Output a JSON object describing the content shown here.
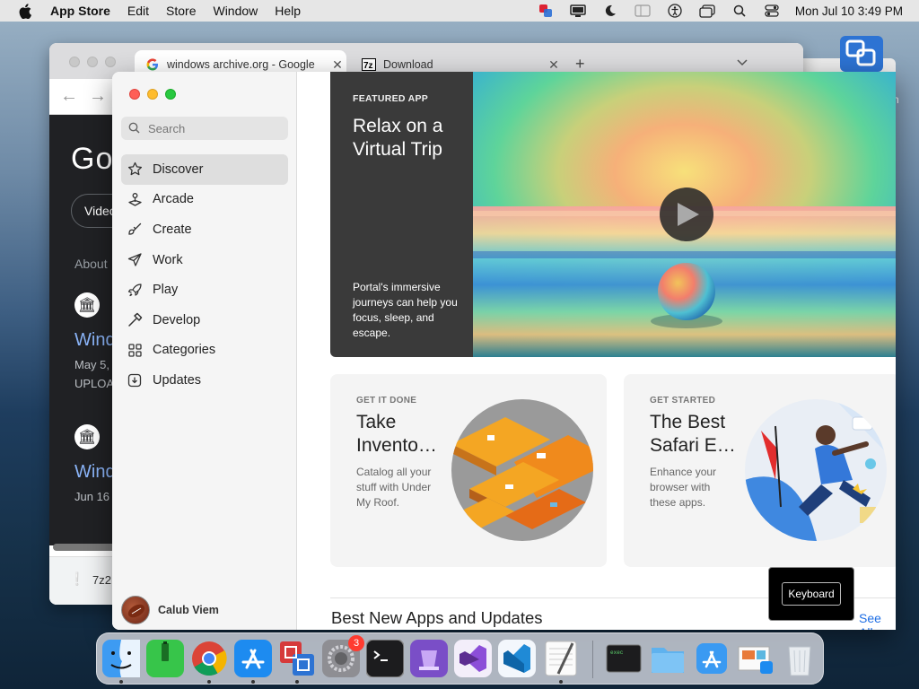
{
  "menubar": {
    "app_name": "App Store",
    "menus": [
      "Edit",
      "Store",
      "Window",
      "Help"
    ],
    "clock": "Mon Jul 10  3:49 PM"
  },
  "browser": {
    "tabs": [
      {
        "label": "windows archive.org - Google",
        "icon": "google-g-icon"
      },
      {
        "label": "Download",
        "icon": "7zip-icon"
      }
    ],
    "page": {
      "logo_text": "Goo",
      "pill_label": "Video",
      "about_text": "About",
      "results": [
        {
          "title": "Wind",
          "meta1": "May 5,",
          "meta2": "UPLOA"
        },
        {
          "title": "Wind",
          "meta1": "Jun 16"
        }
      ]
    },
    "download": {
      "file": "7z2"
    }
  },
  "appstore": {
    "search_placeholder": "Search",
    "nav": [
      {
        "label": "Discover",
        "icon": "star-icon",
        "selected": true
      },
      {
        "label": "Arcade",
        "icon": "joystick-icon"
      },
      {
        "label": "Create",
        "icon": "brush-icon"
      },
      {
        "label": "Work",
        "icon": "paperplane-icon"
      },
      {
        "label": "Play",
        "icon": "rocket-icon"
      },
      {
        "label": "Develop",
        "icon": "hammer-icon"
      },
      {
        "label": "Categories",
        "icon": "grid-icon"
      },
      {
        "label": "Updates",
        "icon": "download-icon"
      }
    ],
    "user": {
      "name": "Calub Viem"
    },
    "featured": {
      "eyebrow": "FEATURED APP",
      "headline": "Relax on a Virtual Trip",
      "blurb": "Portal's immersive journeys can help you focus, sleep, and escape."
    },
    "cards": [
      {
        "eyebrow": "GET IT DONE",
        "title": "Take Invento…",
        "desc": "Catalog all your stuff with Under My Roof."
      },
      {
        "eyebrow": "GET STARTED",
        "title": "The Best Safari E…",
        "desc": "Enhance your browser with these apps."
      }
    ],
    "section_title": "Best New Apps and Updates",
    "see_all": "See All"
  },
  "keyboard_popup": {
    "label": "Keyboard"
  },
  "dock": {
    "apps": [
      "finder-icon",
      "terminal-green-icon",
      "chrome-icon",
      "app-store-icon",
      "remote-desktop-icon",
      "system-preferences-icon",
      "terminal-icon",
      "mosaic-icon",
      "visual-studio-icon",
      "vscode-icon",
      "textedit-icon",
      "exec-icon",
      "folder-icon",
      "app-store-downloads-icon",
      "preview-icon",
      "trash-icon"
    ],
    "system_prefs_badge": "3"
  },
  "colors": {
    "accent": "#1f6fe5",
    "menubar": "#e6e6e6",
    "sidebar_bg": "#f5f5f5",
    "featured_side": "#3a3a3a"
  }
}
